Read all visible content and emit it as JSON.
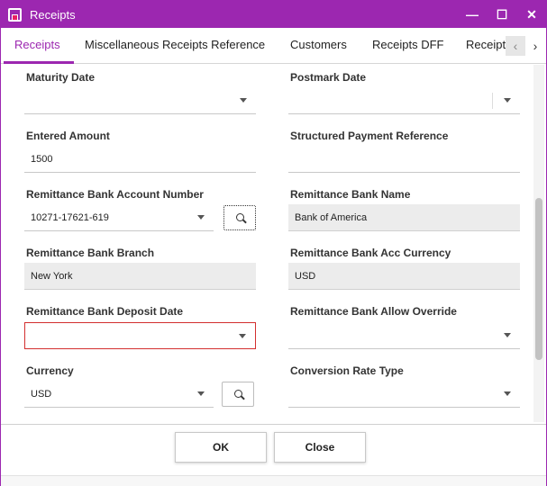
{
  "window": {
    "title": "Receipts",
    "controls": {
      "close": "✕",
      "maximize": "☐",
      "minimize": "—"
    }
  },
  "tabs": {
    "items": [
      {
        "label": "Receipts",
        "active": true
      },
      {
        "label": "Miscellaneous Receipts Reference",
        "active": false
      },
      {
        "label": "Customers",
        "active": false
      },
      {
        "label": "Receipts DFF",
        "active": false
      },
      {
        "label": "Receipt",
        "active": false
      }
    ],
    "prev_arrow": "‹",
    "next_arrow": "›"
  },
  "form": {
    "maturity_date": {
      "label": "Maturity Date",
      "value": ""
    },
    "postmark_date": {
      "label": "Postmark Date",
      "value": ""
    },
    "entered_amount": {
      "label": "Entered Amount",
      "value": "1500"
    },
    "structured_payment_reference": {
      "label": "Structured Payment Reference",
      "value": ""
    },
    "remittance_bank_account_number": {
      "label": "Remittance Bank Account Number",
      "value": "10271-17621-619"
    },
    "remittance_bank_name": {
      "label": "Remittance Bank Name",
      "value": "Bank of America"
    },
    "remittance_bank_branch": {
      "label": "Remittance Bank Branch",
      "value": "New York"
    },
    "remittance_bank_acc_currency": {
      "label": "Remittance Bank Acc Currency",
      "value": "USD"
    },
    "remittance_bank_deposit_date": {
      "label": "Remittance Bank Deposit Date",
      "value": ""
    },
    "remittance_bank_allow_override": {
      "label": "Remittance Bank Allow Override",
      "value": ""
    },
    "currency": {
      "label": "Currency",
      "value": "USD"
    },
    "conversion_rate_type": {
      "label": "Conversion Rate Type",
      "value": ""
    }
  },
  "footer": {
    "ok_label": "OK",
    "close_label": "Close"
  },
  "colors": {
    "accent": "#9c27b0",
    "error": "#d32f2f",
    "readonly_bg": "#ececec"
  }
}
